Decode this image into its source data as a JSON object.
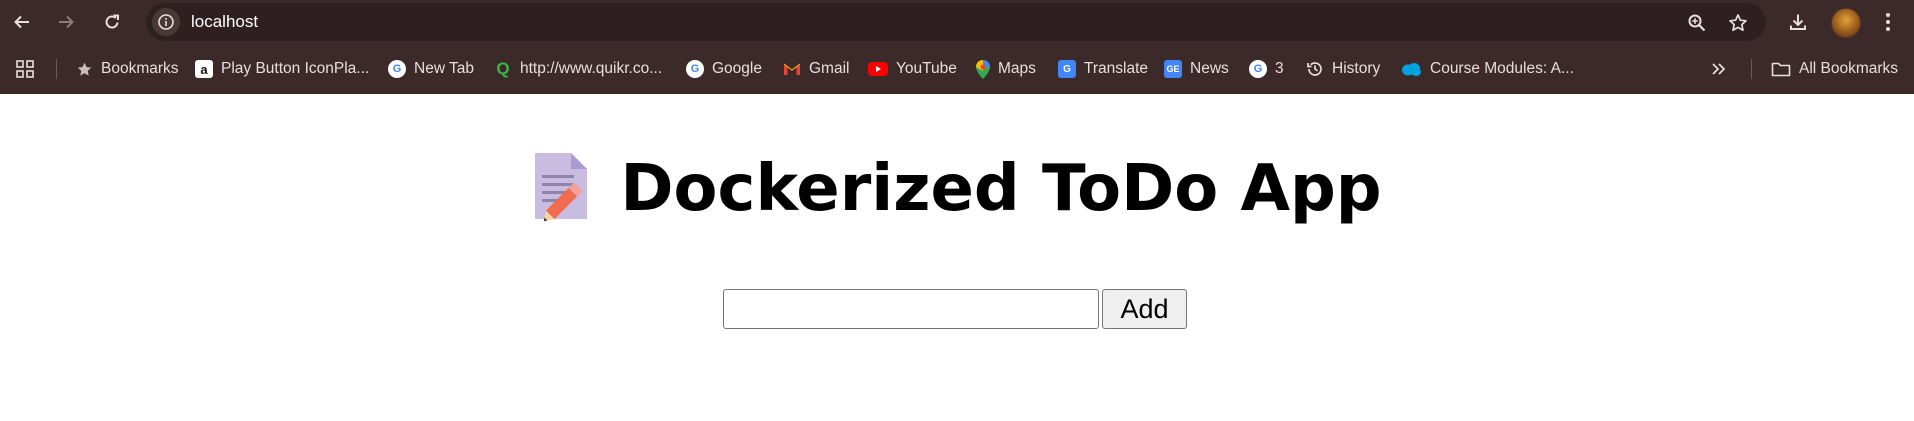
{
  "browser": {
    "url": "localhost",
    "bookmarks": [
      {
        "label": "Bookmarks",
        "icon": "star-icon"
      },
      {
        "label": "Play Button IconPla...",
        "icon": "amazon-icon"
      },
      {
        "label": "New Tab",
        "icon": "google-icon"
      },
      {
        "label": "http://www.quikr.co...",
        "icon": "quikr-icon"
      },
      {
        "label": "Google",
        "icon": "google-icon"
      },
      {
        "label": "Gmail",
        "icon": "gmail-icon"
      },
      {
        "label": "YouTube",
        "icon": "youtube-icon"
      },
      {
        "label": "Maps",
        "icon": "maps-icon"
      },
      {
        "label": "Translate",
        "icon": "translate-icon"
      },
      {
        "label": "News",
        "icon": "news-icon"
      },
      {
        "label": "3",
        "icon": "google-icon"
      },
      {
        "label": "History",
        "icon": "history-icon"
      },
      {
        "label": "Course Modules: A...",
        "icon": "salesforce-icon"
      }
    ],
    "all_bookmarks_label": "All Bookmarks",
    "colors": {
      "chrome_bg": "#3c2a2b",
      "omnibox_bg": "#2e2021",
      "text": "#e8dede"
    }
  },
  "page": {
    "title": "Dockerized ToDo App",
    "title_icon": "memo-icon",
    "todo_input": {
      "value": "",
      "placeholder": ""
    },
    "add_button_label": "Add"
  }
}
